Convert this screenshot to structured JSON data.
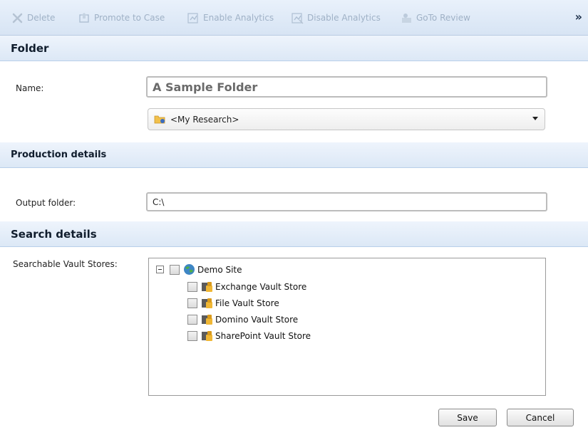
{
  "toolbar": {
    "items": [
      {
        "label": "Delete",
        "icon": "delete-icon"
      },
      {
        "label": "Promote to Case",
        "icon": "promote-icon"
      },
      {
        "label": "Enable Analytics",
        "icon": "enable-analytics-icon"
      },
      {
        "label": "Disable Analytics",
        "icon": "disable-analytics-icon"
      },
      {
        "label": "GoTo Review",
        "icon": "review-icon"
      }
    ],
    "more": "»"
  },
  "folder": {
    "title": "Folder",
    "name_label": "Name:",
    "name_value": "A Sample Folder",
    "location_value": "<My Research>"
  },
  "production": {
    "title": "Production details",
    "output_label": "Output folder:",
    "output_value": "C:\\"
  },
  "search": {
    "title": "Search details",
    "stores_label": "Searchable Vault Stores:",
    "tree": {
      "root": "Demo Site",
      "children": [
        "Exchange Vault Store",
        "File Vault Store",
        "Domino Vault Store",
        "SharePoint Vault Store"
      ]
    }
  },
  "actions": {
    "save": "Save",
    "cancel": "Cancel"
  },
  "colors": {
    "section_bg": "#e3ecf8",
    "toolbar_text_disabled": "#9fb1c6"
  }
}
